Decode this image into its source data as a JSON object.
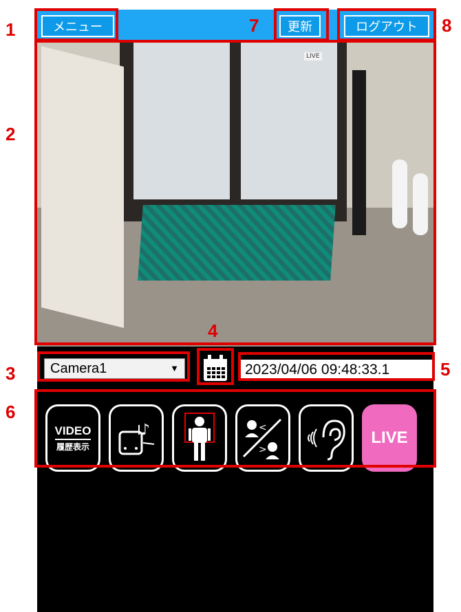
{
  "header": {
    "menu_label": "メニュー",
    "refresh_label": "更新",
    "logout_label": "ログアウト"
  },
  "video": {
    "live_overlay": "LIVE"
  },
  "controls": {
    "camera_selected": "Camera1",
    "datetime": "2023/04/06 09:48:33.1"
  },
  "icons": [
    {
      "name": "video-history-button",
      "line1": "VIDEO",
      "line2": "履歴表示"
    },
    {
      "name": "speaker-music-icon"
    },
    {
      "name": "person-detect-icon"
    },
    {
      "name": "talk-mute-icon"
    },
    {
      "name": "listen-ear-icon"
    },
    {
      "name": "live-button",
      "label": "LIVE"
    }
  ],
  "annotations": [
    "1",
    "2",
    "3",
    "4",
    "5",
    "6",
    "7",
    "8"
  ],
  "colors": {
    "header_bg": "#1fa6f4",
    "annotation": "#e00000",
    "live_bg": "#f06bc0"
  }
}
